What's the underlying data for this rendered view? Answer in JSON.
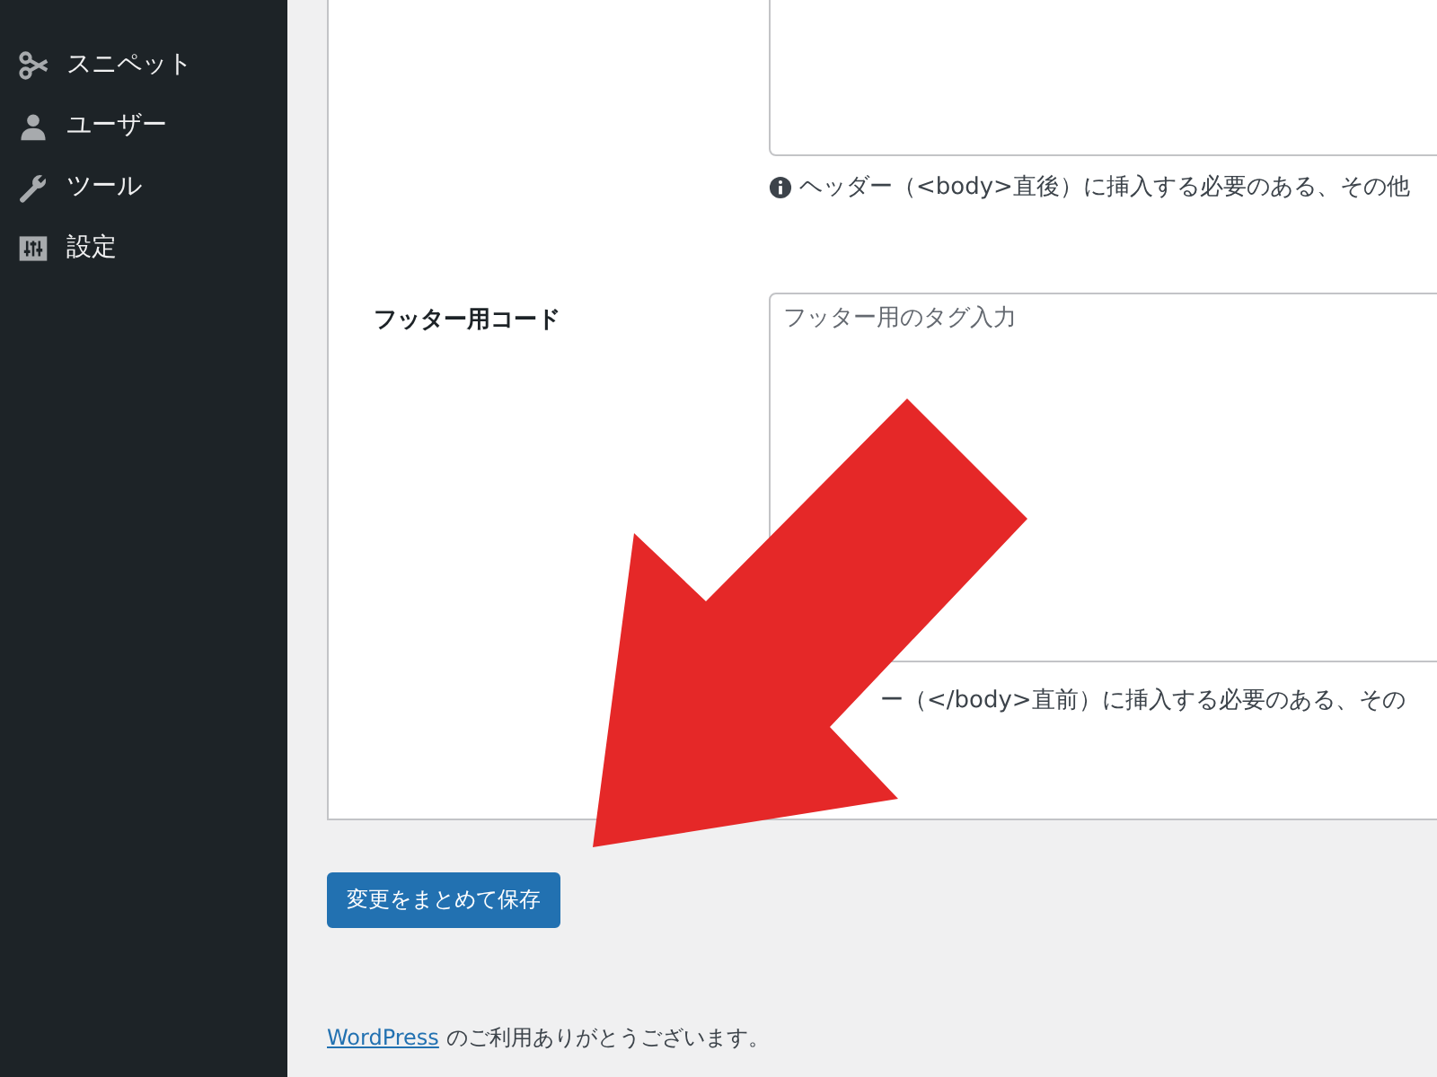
{
  "sidebar": {
    "items": [
      {
        "kind": "scissors",
        "label": "スニペット"
      },
      {
        "kind": "user",
        "label": "ユーザー"
      },
      {
        "kind": "wrench",
        "label": "ツール"
      },
      {
        "kind": "sliders",
        "label": "設定"
      }
    ]
  },
  "settings": {
    "header_code": {
      "help": "ヘッダー（<body>直後）に挿入する必要のある、その他"
    },
    "footer_code": {
      "label": "フッター用コード",
      "placeholder": "フッター用のタグ入力",
      "help": "ー（</body>直前）に挿入する必要のある、その"
    }
  },
  "save_button": "変更をまとめて保存",
  "footer": {
    "link": "WordPress",
    "text": "のご利用ありがとうございます。"
  }
}
